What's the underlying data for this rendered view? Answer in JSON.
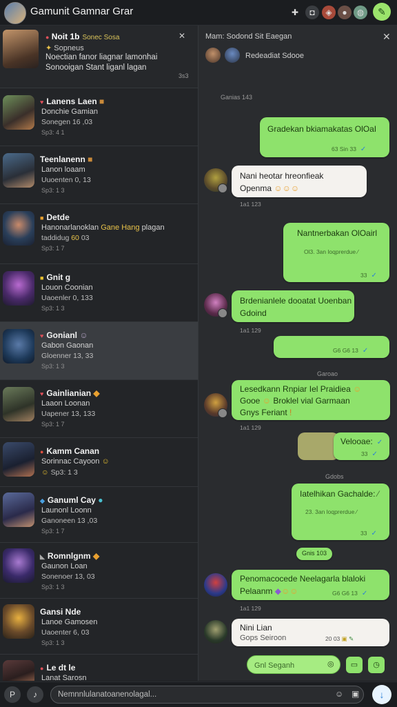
{
  "header": {
    "title": "Gamunit Gamnar Grar",
    "icons": [
      "puzzle-icon",
      "camera-icon",
      "grid-icon",
      "user-icon",
      "globe-icon"
    ],
    "compose_icon": "compose-icon"
  },
  "pinned": {
    "name": "Noit 1b",
    "tag": "Sonec Sosa",
    "line2": "Sopneus",
    "line3": "Noectian fanor liagnar lamonhai",
    "line4": "Sonooigan Stant liganl lagan",
    "time": "3s3",
    "close": "✕"
  },
  "chats": [
    {
      "name": "Lanens Laen",
      "line2": "Donchie Gamian",
      "line3": "Sonegen 16 ,03",
      "time": "Sp3: 4 1"
    },
    {
      "name": "Teenlanenn",
      "line2": "Lanon loaam",
      "line3": "Uuoenten 0, 13",
      "time": "Sp3: 1 3"
    },
    {
      "name": "Detde",
      "line2": "Hanonarlanoklan",
      "line2_hl": "Gane Hang",
      "line2_tail": "plagan",
      "line3": "taddidug",
      "line3_hl": "60",
      "line3_tail": "03",
      "time": "Sp3: 1 7"
    },
    {
      "name": "Gnit g",
      "line2": "Louon Coonian",
      "line3": "Uaoenler 0, 133",
      "time": "Sp3: 1 3"
    },
    {
      "name": "Gonianl",
      "line2": "Gabon Gaonan",
      "line3": "Gloenner 13, 33",
      "time": "Sp3: 1 3"
    },
    {
      "name": "Gainlianian",
      "line2": "Laaon Loonan",
      "line3": "Uapener 13, 133",
      "time": "Sp3: 1 7"
    },
    {
      "name": "Kamm Canan",
      "line2": "Sorinnac Cayoon",
      "line3": "",
      "time": "Sp3: 1 3"
    },
    {
      "name": "Ganuml Cay",
      "line2": "Launonl Loonn",
      "line3": "Ganoneen 13 ,03",
      "time": "Sp3: 1 7"
    },
    {
      "name": "Romnlgnm",
      "line2": "Gaunon Loan",
      "line3": "Sonenoer 13, 03",
      "time": "Sp3: 1 3"
    },
    {
      "name": "Gansi Nde",
      "line2": "Lanoe Gamosen",
      "line3": "Uaoenter 6, 03",
      "time": "Sp3: 1 3"
    },
    {
      "name": "Le dt le",
      "line2": "Lanat Sarosn",
      "line3": "",
      "time": ""
    }
  ],
  "conversation": {
    "title": "Mam: Sodond Sit Eaegan",
    "subtitle": "Redeadiat Sdooe",
    "close": "✕",
    "divider1": "Ganias 143",
    "divider2": "Garoao",
    "divider3": "Gdobs",
    "pill": "Gnis 103",
    "messages": {
      "m1": {
        "text": "Gradekan bkiamakatas OlOaI",
        "meta": "63 Sin 33"
      },
      "m2": {
        "line1": "Nani heotar hreonfieak",
        "line2": "Openma",
        "time": "1a1 123"
      },
      "m3": {
        "text": "Nantnerbakan OlOairl",
        "meta1": "Ol3. 3an loqprerdue",
        "meta2": "33"
      },
      "m4": {
        "line1": "Brdenianlele dooatat Uoenban",
        "line2": "Gdoind",
        "time": "1a1 129"
      },
      "m5": {
        "meta": "G6 G6 13"
      },
      "m6": {
        "line1": "Lesedkann Rnpiar Iel Praidiea",
        "line2": "Gooe",
        "line2b": "Broklel vial Garmaan",
        "line3": "Gnys Feriant",
        "time": "1a1 129"
      },
      "m7": {
        "text": "Velooae:",
        "meta": "33"
      },
      "m8": {
        "text": "Iatelhikan Gachalde:",
        "meta1": "23. 3an loqprerdue",
        "meta2": "33"
      },
      "m9": {
        "line1": "Penomacocede Neelagarla blaloki",
        "line2": "Pelaanm",
        "meta": "G6 G6 13",
        "time": "1a1 129"
      },
      "m10": {
        "line1": "Nini Lian",
        "line2": "Gops Seiroon",
        "meta": "20 03"
      }
    },
    "search_placeholder": "Gnl Seganh"
  },
  "bottom": {
    "placeholder": "Nemnnlulanatoanenolagal..."
  },
  "colors": {
    "bubble_green": "#8ee26c",
    "bubble_white": "#f4f2ee",
    "background": "#2a2c2f",
    "accent_blue": "#2b7fd6"
  }
}
